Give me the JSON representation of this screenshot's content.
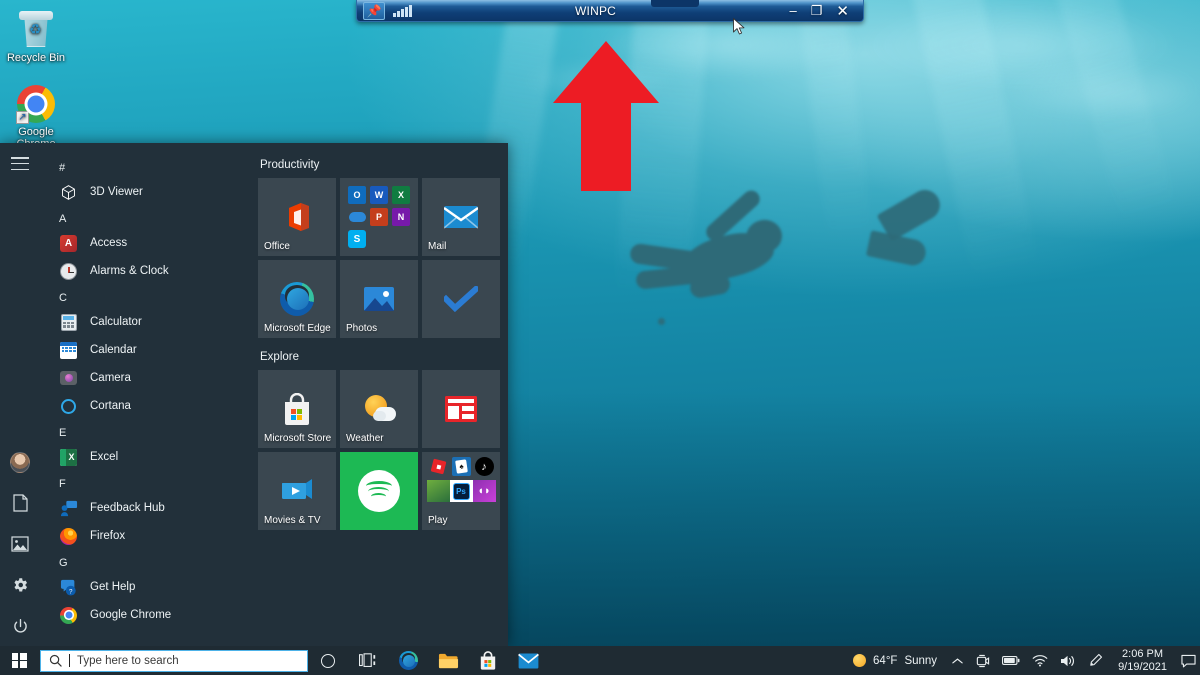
{
  "desktop": {
    "icons": [
      {
        "label": "Recycle Bin",
        "icon": "recycle-bin-icon"
      },
      {
        "label": "Google Chrome",
        "icon": "google-chrome-icon"
      }
    ]
  },
  "annotation": {
    "shape": "up-arrow",
    "color": "#ED1C24",
    "points_at": "rdp-connection-bar"
  },
  "rdp_bar": {
    "title": "WINPC",
    "pin_icon": "pushpin-icon",
    "signal_icon": "signal-bars-icon",
    "minimize_label": "–",
    "restore_label": "❐",
    "close_label": "✕"
  },
  "start_menu": {
    "hamburger_icon": "hamburger-menu-icon",
    "rail_items": [
      {
        "name": "user-avatar",
        "icon": "avatar-icon"
      },
      {
        "name": "documents",
        "icon": "document-icon"
      },
      {
        "name": "pictures",
        "icon": "pictures-icon"
      },
      {
        "name": "settings",
        "icon": "gear-icon"
      },
      {
        "name": "power",
        "icon": "power-icon"
      }
    ],
    "app_list": [
      {
        "type": "alpha",
        "label": "#"
      },
      {
        "type": "app",
        "label": "3D Viewer",
        "icon": "3d-viewer-icon"
      },
      {
        "type": "alpha",
        "label": "A"
      },
      {
        "type": "app",
        "label": "Access",
        "icon": "access-icon"
      },
      {
        "type": "app",
        "label": "Alarms & Clock",
        "icon": "alarms-clock-icon"
      },
      {
        "type": "alpha",
        "label": "C"
      },
      {
        "type": "app",
        "label": "Calculator",
        "icon": "calculator-icon"
      },
      {
        "type": "app",
        "label": "Calendar",
        "icon": "calendar-icon"
      },
      {
        "type": "app",
        "label": "Camera",
        "icon": "camera-icon"
      },
      {
        "type": "app",
        "label": "Cortana",
        "icon": "cortana-icon"
      },
      {
        "type": "alpha",
        "label": "E"
      },
      {
        "type": "app",
        "label": "Excel",
        "icon": "excel-icon"
      },
      {
        "type": "alpha",
        "label": "F"
      },
      {
        "type": "app",
        "label": "Feedback Hub",
        "icon": "feedback-hub-icon"
      },
      {
        "type": "app",
        "label": "Firefox",
        "icon": "firefox-icon"
      },
      {
        "type": "alpha",
        "label": "G"
      },
      {
        "type": "app",
        "label": "Get Help",
        "icon": "get-help-icon"
      },
      {
        "type": "app",
        "label": "Google Chrome",
        "icon": "google-chrome-icon"
      }
    ],
    "tile_groups": [
      {
        "title": "Productivity",
        "tiles": [
          {
            "label": "Office",
            "icon": "office-icon"
          },
          {
            "label": "",
            "icon": "office-suite-folder-icon"
          },
          {
            "label": "Mail",
            "icon": "mail-icon"
          },
          {
            "label": "Microsoft Edge",
            "icon": "edge-icon"
          },
          {
            "label": "Photos",
            "icon": "photos-icon"
          },
          {
            "label": "",
            "icon": "todo-icon"
          }
        ]
      },
      {
        "title": "Explore",
        "tiles": [
          {
            "label": "Microsoft Store",
            "icon": "microsoft-store-icon"
          },
          {
            "label": "Weather",
            "icon": "weather-icon"
          },
          {
            "label": "",
            "icon": "news-icon"
          },
          {
            "label": "Movies & TV",
            "icon": "movies-tv-icon"
          },
          {
            "label": "",
            "icon": "spotify-icon"
          },
          {
            "label": "Play",
            "icon": "play-folder-icon"
          }
        ]
      }
    ]
  },
  "taskbar": {
    "start_icon": "windows-start-icon",
    "search": {
      "placeholder": "Type here to search",
      "value": "",
      "icon": "search-icon"
    },
    "buttons": [
      {
        "name": "cortana",
        "icon": "cortana-circle-icon"
      },
      {
        "name": "task-view",
        "icon": "task-view-icon"
      },
      {
        "name": "microsoft-edge",
        "icon": "edge-icon"
      },
      {
        "name": "file-explorer",
        "icon": "file-explorer-icon"
      },
      {
        "name": "microsoft-store",
        "icon": "microsoft-store-icon"
      },
      {
        "name": "mail",
        "icon": "mail-icon"
      }
    ],
    "tray": {
      "weather_temp": "64°F",
      "weather_cond": "Sunny",
      "icons": [
        {
          "name": "show-hidden-icons",
          "icon": "chevron-up-icon"
        },
        {
          "name": "meet-now",
          "icon": "meet-now-icon"
        },
        {
          "name": "battery",
          "icon": "battery-icon"
        },
        {
          "name": "network",
          "icon": "wifi-icon"
        },
        {
          "name": "volume",
          "icon": "speaker-icon"
        },
        {
          "name": "pen-menu",
          "icon": "pen-icon"
        }
      ],
      "time": "2:06 PM",
      "date": "9/19/2021",
      "action_center_icon": "action-center-icon"
    }
  }
}
